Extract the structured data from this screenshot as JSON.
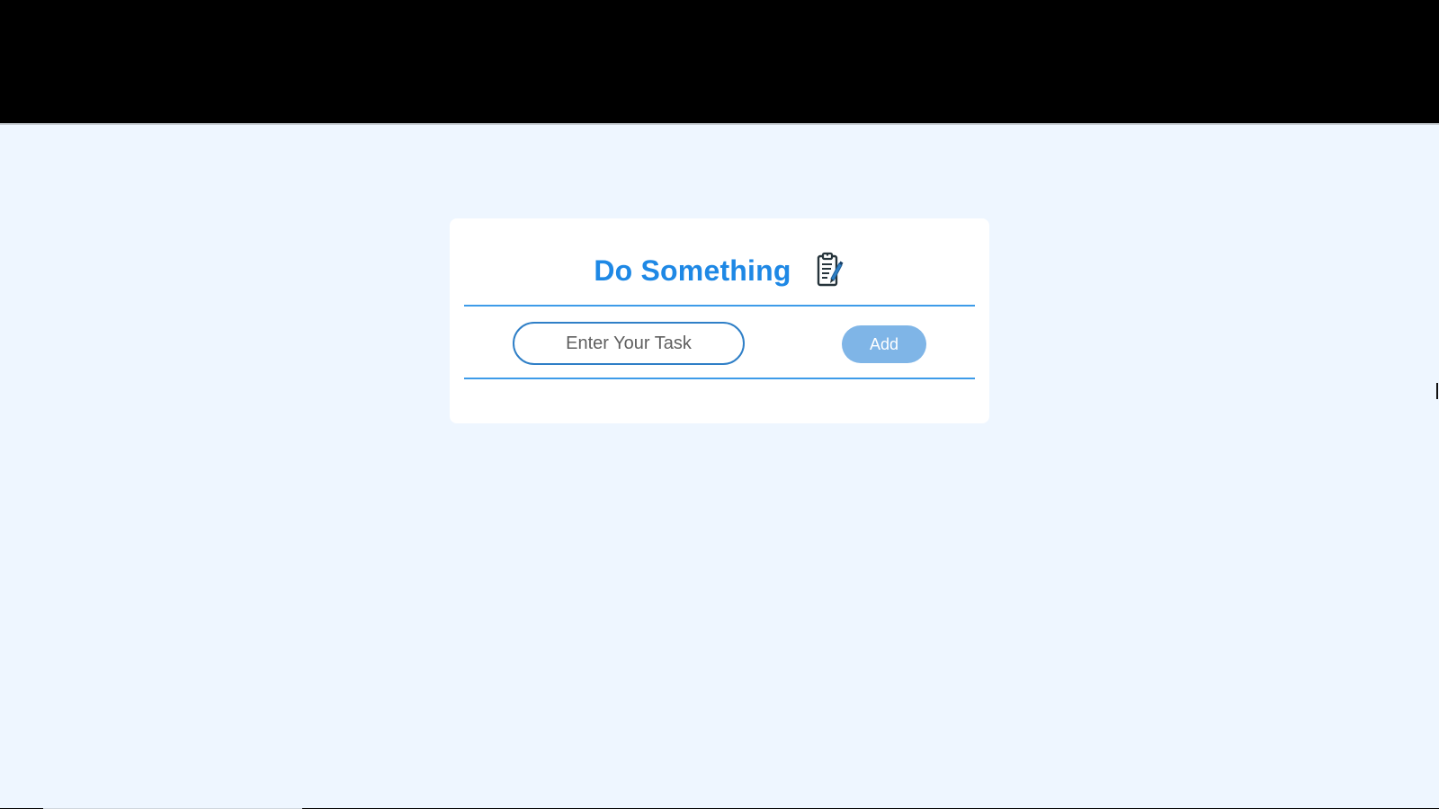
{
  "app": {
    "title": "Do Something",
    "title_icon": "clipboard-edit-icon"
  },
  "task_form": {
    "input_placeholder": "Enter Your Task",
    "input_value": "",
    "add_label": "Add"
  },
  "colors": {
    "page_background": "#eef6ff",
    "card_background": "#ffffff",
    "title_color": "#1e88e5",
    "divider_color": "#3d9be9",
    "input_border": "#2f7fc7",
    "add_button_background": "#7fb5e7",
    "add_button_text": "#ffffff",
    "top_bar": "#000000"
  }
}
